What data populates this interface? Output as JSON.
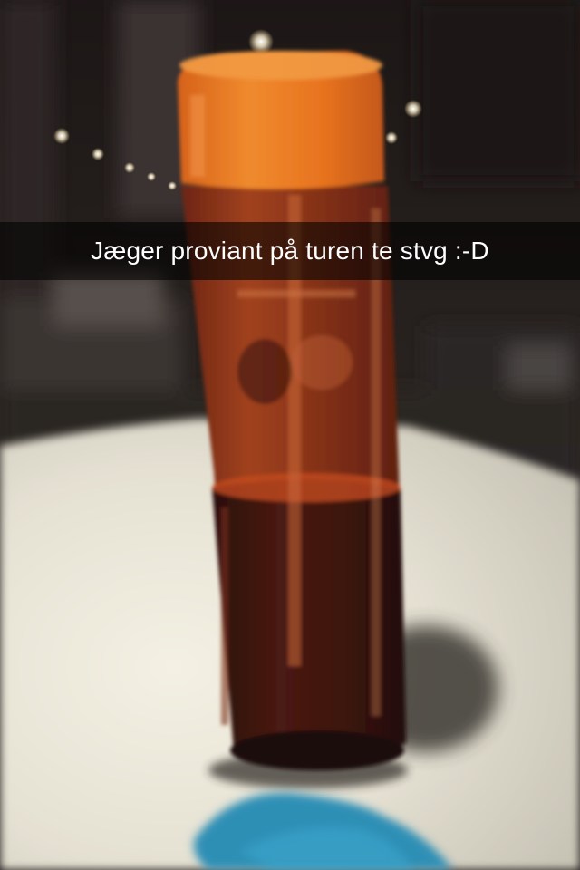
{
  "snap": {
    "caption": "Jæger proviant på turen te stvg :-D"
  },
  "photo": {
    "subject": "orange-capped plastic bottle on a white table",
    "colors": {
      "cap": "#e8731e",
      "liquid": "#3a1410",
      "bottle_tint": "#a8401c",
      "table": "#e7e3d6",
      "background": "#171312",
      "cloth": "#2d8fb5"
    }
  }
}
